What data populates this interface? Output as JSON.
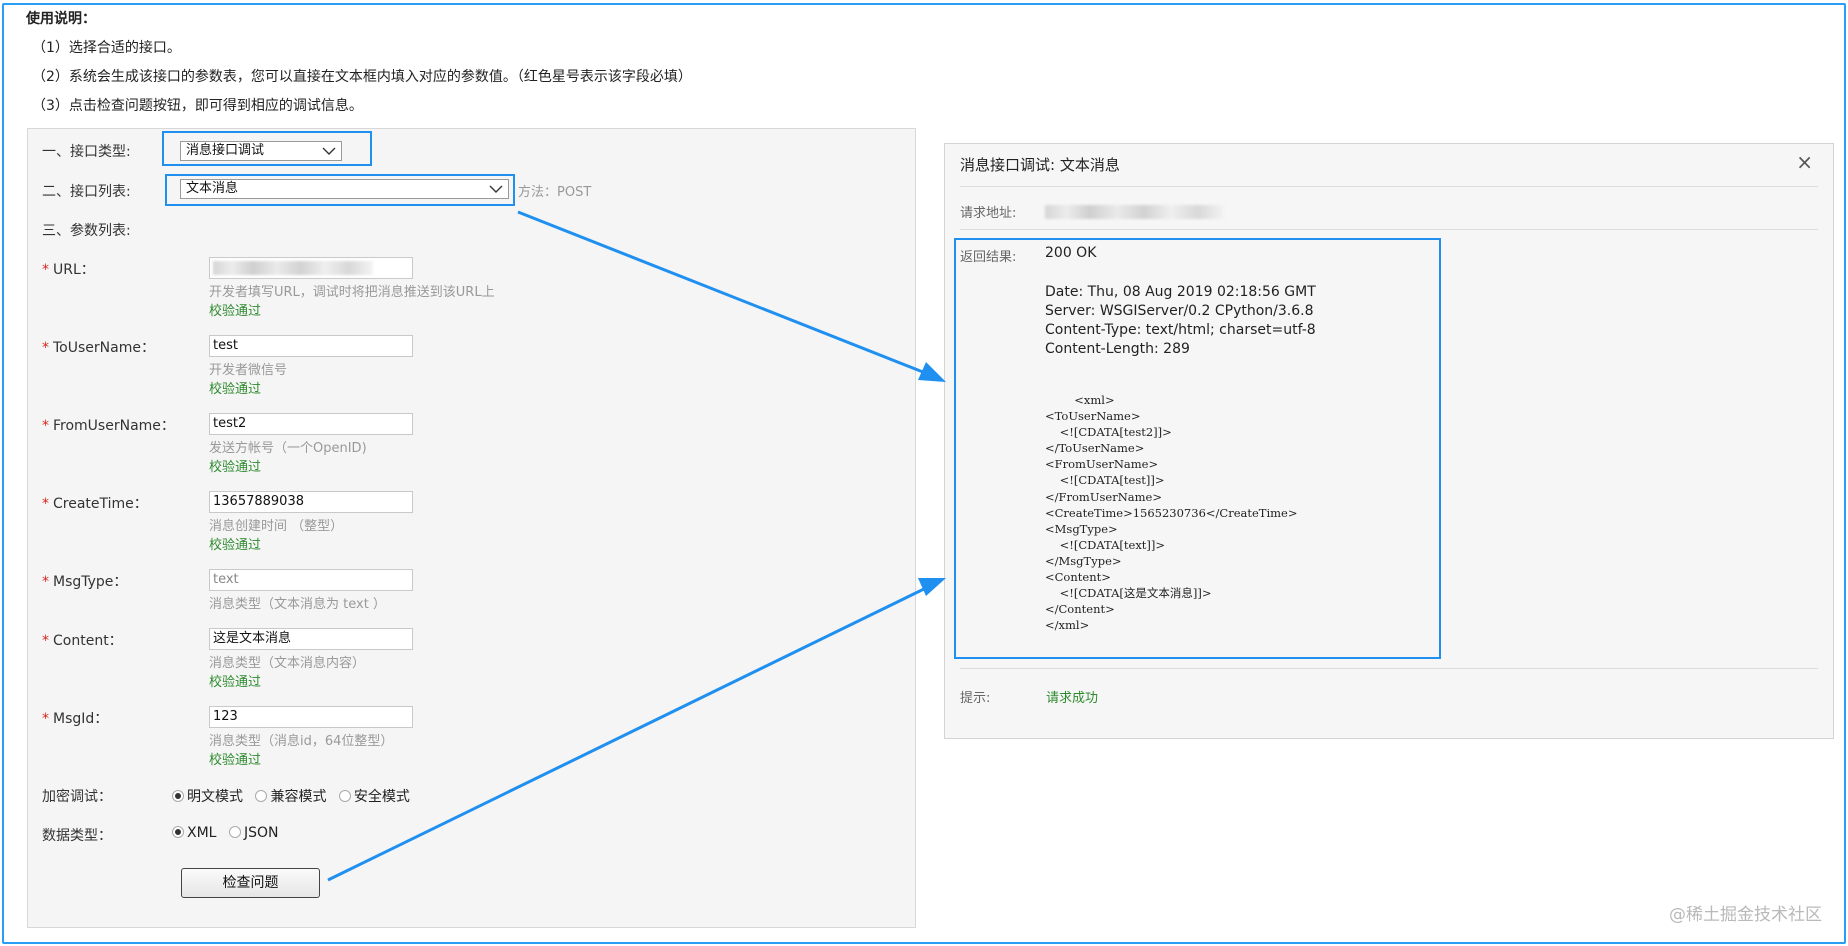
{
  "instructions": {
    "title": "使用说明：",
    "lines": [
      "（1）选择合适的接口。",
      "（2）系统会生成该接口的参数表，您可以直接在文本框内填入对应的参数值。（红色星号表示该字段必填）",
      "（3）点击检查问题按钮，即可得到相应的调试信息。"
    ]
  },
  "form": {
    "interface_type_label": "一、接口类型:",
    "interface_type_value": "消息接口调试",
    "interface_list_label": "二、接口列表:",
    "interface_list_value": "文本消息",
    "method_text": "方法：POST",
    "param_list_label": "三、参数列表:",
    "required_mark": "*",
    "verified_text": "校验通过",
    "params": [
      {
        "label": "URL：",
        "value": "",
        "hint": "开发者填写URL，调试时将把消息推送到该URL上",
        "verified": true
      },
      {
        "label": "ToUserName：",
        "value": "test",
        "hint": "开发者微信号",
        "verified": true
      },
      {
        "label": "FromUserName：",
        "value": "test2",
        "hint": "发送方帐号（一个OpenID)",
        "verified": true
      },
      {
        "label": "CreateTime：",
        "value": "13657889038",
        "hint": "消息创建时间 （整型）",
        "verified": true
      },
      {
        "label": "MsgType：",
        "value": "text",
        "hint": "消息类型（文本消息为 text ）",
        "verified": false
      },
      {
        "label": "Content：",
        "value": "这是文本消息",
        "hint": "消息类型（文本消息内容）",
        "verified": true
      },
      {
        "label": "MsgId：",
        "value": "123",
        "hint": "消息类型（消息id，64位整型）",
        "verified": true
      }
    ],
    "encrypt_label": "加密调试：",
    "encrypt_options": [
      "明文模式",
      "兼容模式",
      "安全模式"
    ],
    "encrypt_selected": "明文模式",
    "datatype_label": "数据类型：",
    "datatype_options": [
      "XML",
      "JSON"
    ],
    "datatype_selected": "XML",
    "check_button": "检查问题"
  },
  "result": {
    "title": "消息接口调试: 文本消息",
    "close_glyph": "×",
    "request_url_label": "请求地址:",
    "response_label": "返回结果:",
    "status": "200 OK",
    "headers": [
      "Date: Thu, 08 Aug 2019 02:18:56 GMT",
      "Server: WSGIServer/0.2 CPython/3.6.8",
      "Content-Type: text/html; charset=utf-8",
      "Content-Length: 289"
    ],
    "body": "        <xml>\n<ToUserName>\n    <![CDATA[test2]]>\n</ToUserName>\n<FromUserName>\n    <![CDATA[test]]>\n</FromUserName>\n<CreateTime>1565230736</CreateTime>\n<MsgType>\n    <![CDATA[text]]>\n</MsgType>\n<Content>\n    <![CDATA[这是文本消息]]>\n</Content>\n</xml>",
    "tip_label": "提示:",
    "tip_value": "请求成功"
  },
  "watermark": "@稀土掘金技术社区",
  "colors": {
    "highlight": "#1f8ff0",
    "success": "#2e8b2e",
    "required": "#d9261c"
  }
}
